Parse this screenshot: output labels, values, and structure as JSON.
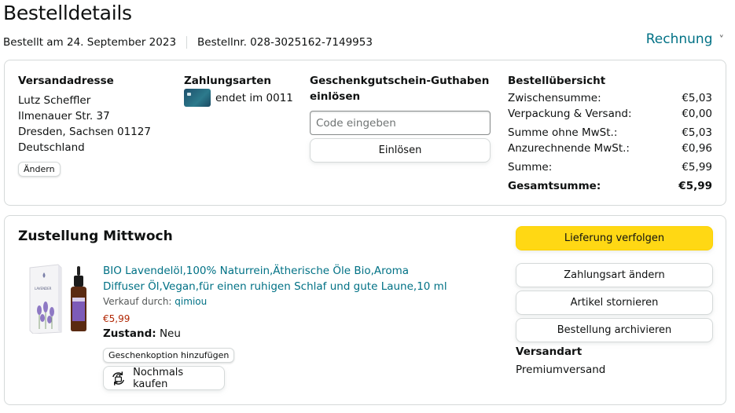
{
  "page": {
    "title": "Bestelldetails",
    "ordered_on": "Bestellt am 24. September 2023",
    "order_number": "Bestellnr. 028-3025162-7149953",
    "invoice_label": "Rechnung",
    "invoice_chevron": "˅"
  },
  "address": {
    "heading": "Versandadresse",
    "lines": [
      "Lutz Scheffler",
      "Ilmenauer Str. 37",
      "Dresden, Sachsen 01127",
      "Deutschland"
    ],
    "change_label": "Ändern"
  },
  "payment": {
    "heading": "Zahlungsarten",
    "card_text": "endet im 0011",
    "icon": "credit-card-icon"
  },
  "giftcard": {
    "heading": "Geschenkgutschein-Guthaben einlösen",
    "input_placeholder": "Code eingeben",
    "input_value": "",
    "redeem_label": "Einlösen"
  },
  "summary": {
    "heading": "Bestellübersicht",
    "rows": [
      {
        "label": "Zwischensumme:",
        "value": "€5,03"
      },
      {
        "label": "Verpackung & Versand:",
        "value": "€0,00"
      },
      {
        "label": "Summe ohne MwSt.:",
        "value": "€5,03"
      },
      {
        "label": "Anzurechnende MwSt.:",
        "value": "€0,96"
      },
      {
        "label": "Summe:",
        "value": "€5,99"
      },
      {
        "label": "Gesamtsumme:",
        "value": "€5,99"
      }
    ]
  },
  "delivery": {
    "heading": "Zustellung Mittwoch",
    "product": {
      "title": "BIO Lavendelöl,100% Naturrein,Ätherische Öle Bio,Aroma Diffuser Öl,Vegan,für einen ruhigen Schlaf und gute Laune,10 ml",
      "sold_by_label": "Verkauf durch: ",
      "seller": "qimiou",
      "price": "€5,99",
      "condition_label": "Zustand:",
      "condition_value": " Neu",
      "gift_option_label": "Geschenkoption hinzufügen",
      "buy_again_label": "Nochmals kaufen",
      "product_box_text": "LAVENDER"
    },
    "actions": {
      "track": "Lieferung verfolgen",
      "change_payment": "Zahlungsart ändern",
      "cancel": "Artikel stornieren",
      "archive": "Bestellung archivieren"
    },
    "shipping": {
      "heading": "Versandart",
      "value": "Premiumversand"
    }
  },
  "colors": {
    "link": "#007185",
    "primary_button": "#ffd814",
    "price": "#b12704",
    "border": "#d5d9d9"
  }
}
